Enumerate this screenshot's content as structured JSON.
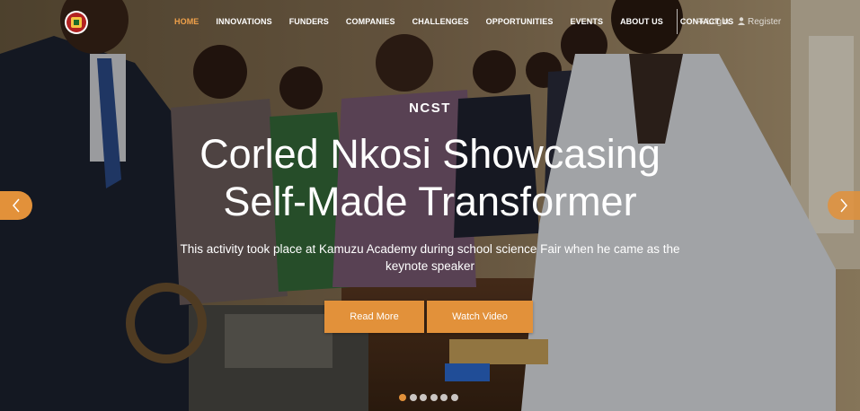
{
  "brand": {
    "logo_text": "NCST",
    "accent_color": "#e2913a",
    "active_nav_color": "#f0a14a"
  },
  "nav": {
    "items": [
      {
        "label": "HOME",
        "active": true
      },
      {
        "label": "INNOVATIONS",
        "active": false
      },
      {
        "label": "FUNDERS",
        "active": false
      },
      {
        "label": "COMPANIES",
        "active": false
      },
      {
        "label": "CHALLENGES",
        "active": false
      },
      {
        "label": "OPPORTUNITIES",
        "active": false
      },
      {
        "label": "EVENTS",
        "active": false
      },
      {
        "label": "ABOUT US",
        "active": false
      },
      {
        "label": "CONTACT US",
        "active": false
      }
    ],
    "login": {
      "label": "Login",
      "icon": "sign-in-icon"
    },
    "register": {
      "label": "Register",
      "icon": "user-icon"
    }
  },
  "slide": {
    "eyebrow": "NCST",
    "headline_line1": "Corled Nkosi Showcasing",
    "headline_line2": "Self-Made Transformer",
    "subtitle": "This activity took place at Kamuzu Academy during school science Fair when he came as the keynote speaker",
    "read_more_label": "Read More",
    "watch_video_label": "Watch Video"
  },
  "carousel": {
    "slide_count": 6,
    "active_index": 0,
    "prev_icon": "chevron-left-icon",
    "next_icon": "chevron-right-icon"
  }
}
